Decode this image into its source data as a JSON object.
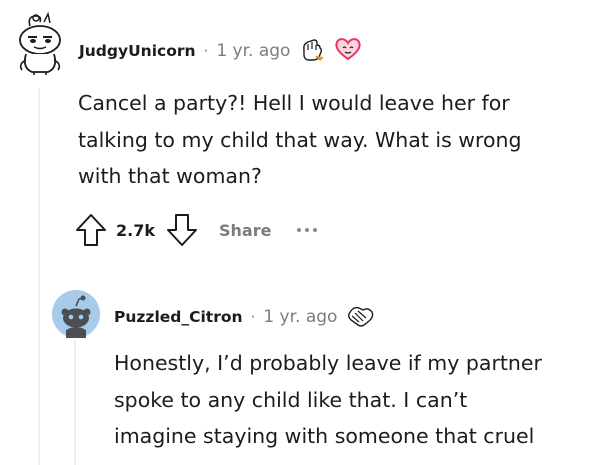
{
  "colors": {
    "text": "#1c1c1c",
    "meta": "#7c7c7c",
    "thread_line": "#edeff1",
    "avatar_blue": "#a7cbe8"
  },
  "comments": [
    {
      "username": "JudgyUnicorn",
      "separator": "·",
      "age": "1 yr. ago",
      "awards": [
        "fist-bump-award-icon",
        "heart-award-icon"
      ],
      "body_lines": [
        "Cancel a party?! Hell I would leave her for",
        "talking to my child that way. What is wrong",
        "with that woman?"
      ],
      "actions": {
        "upvote_count": "2.7k",
        "share_label": "Share"
      },
      "avatar_icon": "unicorn-snoo-avatar-icon"
    },
    {
      "username": "Puzzled_Citron",
      "separator": "·",
      "age": "1 yr. ago",
      "awards": [
        "handshake-award-icon"
      ],
      "body_lines": [
        "Honestly, I’d probably leave if my partner",
        "spoke to any child like that. I can’t",
        "imagine staying with someone that cruel"
      ],
      "avatar_icon": "snoo-avatar-icon"
    }
  ]
}
